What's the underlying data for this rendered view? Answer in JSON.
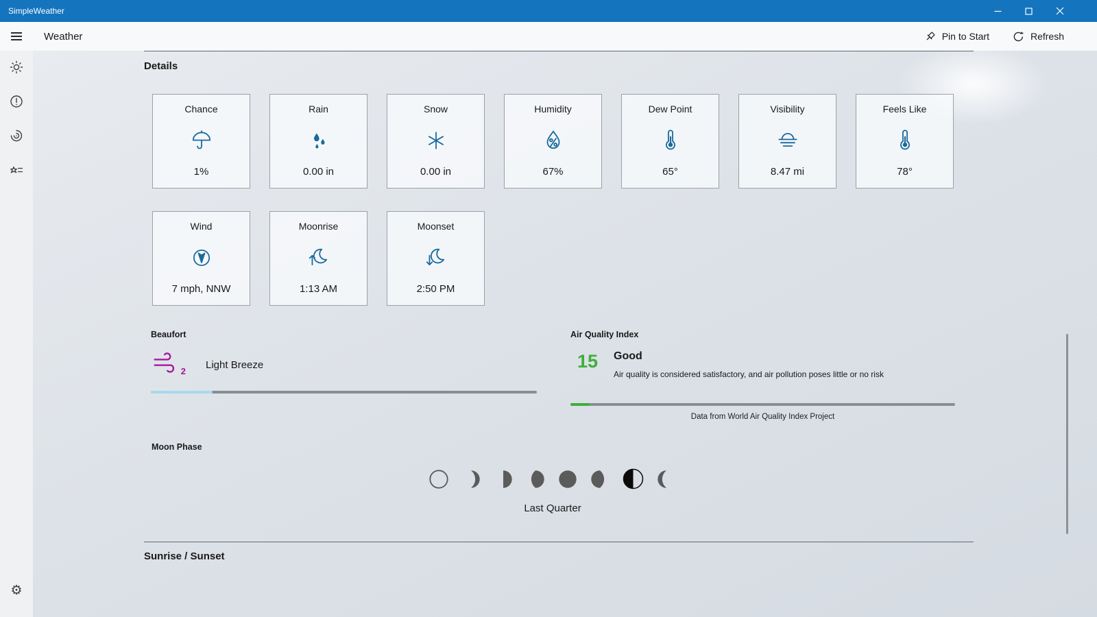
{
  "titlebar": {
    "app_name": "SimpleWeather"
  },
  "header": {
    "title": "Weather",
    "pin_to_start": "Pin to Start",
    "refresh": "Refresh"
  },
  "icons": {
    "gear": "⚙"
  },
  "sidebar": {
    "icon_names": [
      "current-weather",
      "alerts",
      "radar",
      "favorites",
      "settings"
    ]
  },
  "details": {
    "heading": "Details",
    "cards": [
      {
        "label": "Chance",
        "icon": "umbrella-icon",
        "value": "1%"
      },
      {
        "label": "Rain",
        "icon": "raindrops-icon",
        "value": "0.00 in"
      },
      {
        "label": "Snow",
        "icon": "snowflake-icon",
        "value": "0.00 in"
      },
      {
        "label": "Humidity",
        "icon": "humidity-drop-icon",
        "value": "67%"
      },
      {
        "label": "Dew Point",
        "icon": "thermometer-icon",
        "value": "65°"
      },
      {
        "label": "Visibility",
        "icon": "fog-horizon-icon",
        "value": "8.47 mi"
      },
      {
        "label": "Feels Like",
        "icon": "thermometer-icon",
        "value": "78°"
      },
      {
        "label": "Wind",
        "icon": "compass-arrow-icon",
        "value": "7 mph, NNW"
      },
      {
        "label": "Moonrise",
        "icon": "moonrise-icon",
        "value": "1:13 AM"
      },
      {
        "label": "Moonset",
        "icon": "moonset-icon",
        "value": "2:50 PM"
      }
    ]
  },
  "beaufort": {
    "heading": "Beaufort",
    "scale_number": "2",
    "label": "Light Breeze",
    "progress_percent": 16
  },
  "air_quality": {
    "heading": "Air Quality Index",
    "value": "15",
    "category": "Good",
    "description": "Air quality is considered satisfactory, and air pollution poses little or no risk",
    "attribution": "Data from World Air Quality Index Project",
    "progress_percent": 5
  },
  "moon": {
    "heading": "Moon Phase",
    "current_phase": "Last Quarter",
    "phases": [
      {
        "name": "New Moon",
        "selected": false
      },
      {
        "name": "Waxing Crescent",
        "selected": false
      },
      {
        "name": "First Quarter",
        "selected": false
      },
      {
        "name": "Waxing Gibbous",
        "selected": false
      },
      {
        "name": "Full Moon",
        "selected": false
      },
      {
        "name": "Waning Gibbous",
        "selected": false
      },
      {
        "name": "Last Quarter",
        "selected": true
      },
      {
        "name": "Waning Crescent",
        "selected": false
      }
    ]
  },
  "sunrise_sunset": {
    "heading": "Sunrise / Sunset"
  },
  "colors": {
    "accent": "#1474bd",
    "card_icon": "#1a6a9c",
    "beaufort_icon": "#a31a9e",
    "aqi_good": "#3fae3a",
    "beaufort_fill": "#a9d9ed"
  }
}
